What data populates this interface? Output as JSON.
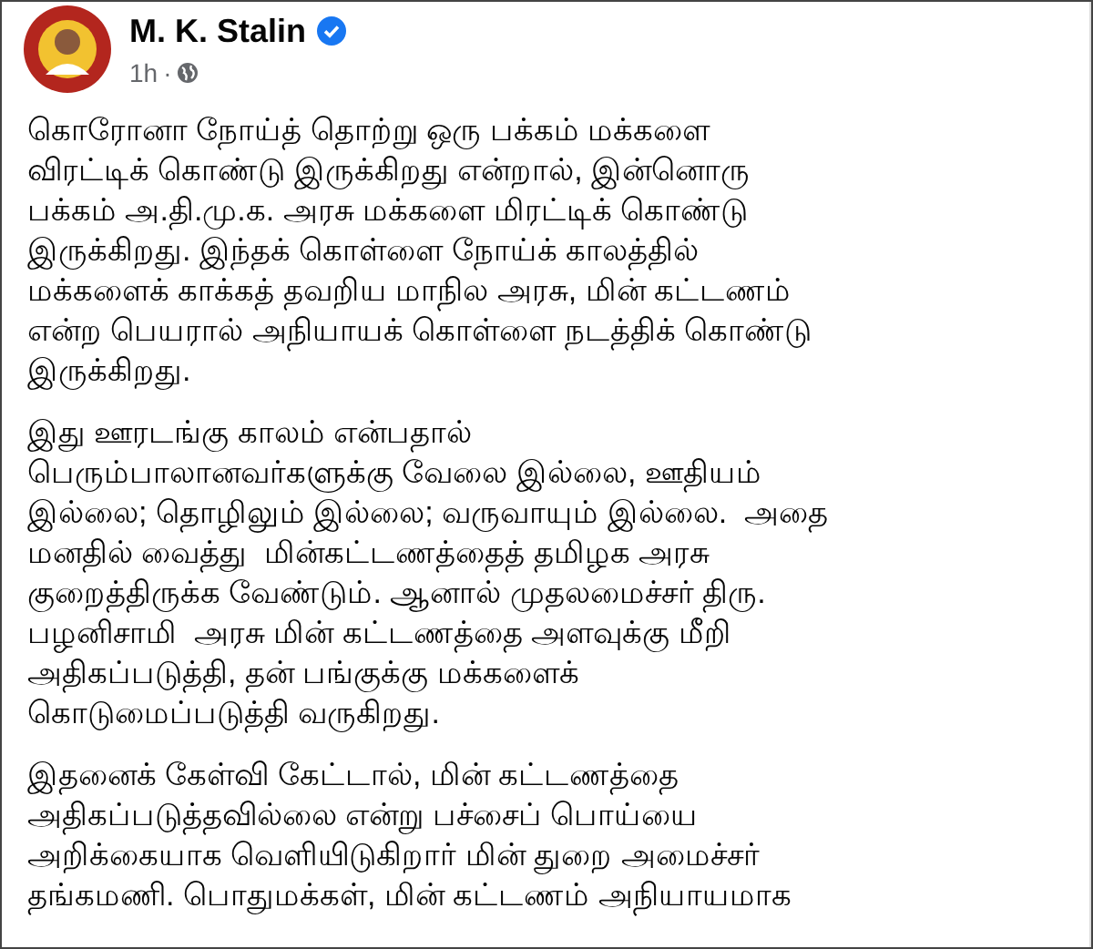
{
  "post": {
    "author": "M. K. Stalin",
    "verified": true,
    "time": "1h",
    "separator": "·",
    "paragraphs": [
      [
        "கொரோனா நோய்த் தொற்று ஒரு பக்கம் மக்களை",
        "விரட்டிக் கொண்டு இருக்கிறது என்றால், இன்னொரு",
        "பக்கம் அ.தி.மு.க. அரசு மக்களை மிரட்டிக் கொண்டு",
        "இருக்கிறது. இந்தக் கொள்ளை நோய்க் காலத்தில்",
        "மக்களைக் காக்கத் தவறிய மாநில அரசு, மின் கட்டணம்",
        "என்ற பெயரால் அநியாயக் கொள்ளை நடத்திக் கொண்டு",
        "இருக்கிறது."
      ],
      [
        "இது ஊரடங்கு காலம் என்பதால்",
        "பெரும்பாலானவர்களுக்கு வேலை இல்லை, ஊதியம்",
        "இல்லை; தொழிலும் இல்லை; வருவாயும் இல்லை.  அதை",
        "மனதில் வைத்து  மின்கட்டணத்தைத் தமிழக அரசு",
        "குறைத்திருக்க வேண்டும். ஆனால் முதலமைச்சர் திரு.",
        "பழனிசாமி  அரசு மின் கட்டணத்தை அளவுக்கு மீறி",
        "அதிகப்படுத்தி, தன் பங்குக்கு மக்களைக்",
        "கொடுமைப்படுத்தி வருகிறது."
      ],
      [
        "இதனைக் கேள்வி கேட்டால், மின் கட்டணத்தை",
        "அதிகப்படுத்தவில்லை என்று பச்சைப் பொய்யை",
        "அறிக்கையாக வெளியிடுகிறார் மின் துறை அமைச்சர்",
        "தங்கமணி. பொதுமக்கள், மின் கட்டணம் அநியாயமாக"
      ]
    ]
  }
}
